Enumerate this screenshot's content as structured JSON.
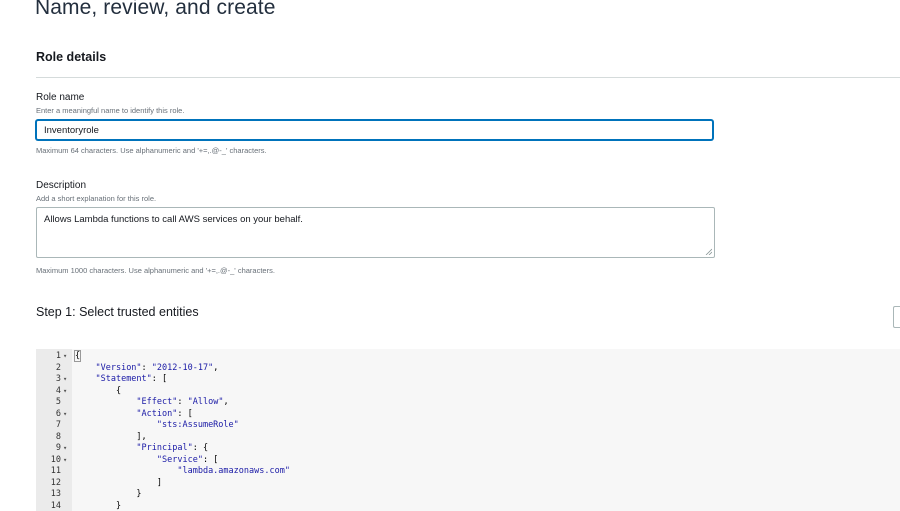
{
  "page": {
    "title": "Name, review, and create"
  },
  "role_details": {
    "title": "Role details",
    "role_name": {
      "label": "Role name",
      "hint": "Enter a meaningful name to identify this role.",
      "value": "Inventoryrole",
      "constraint": "Maximum 64 characters. Use alphanumeric and '+=,.@-_' characters."
    },
    "description": {
      "label": "Description",
      "hint": "Add a short explanation for this role.",
      "value": "Allows Lambda functions to call AWS services on your behalf.",
      "constraint": "Maximum 1000 characters. Use alphanumeric and '+=,.@-_' characters."
    }
  },
  "step1": {
    "title": "Step 1: Select trusted entities"
  },
  "code_editor": {
    "lines": [
      {
        "num": "1",
        "fold": true,
        "code": "{"
      },
      {
        "num": "2",
        "fold": false,
        "code": "    \"Version\": \"2012-10-17\","
      },
      {
        "num": "3",
        "fold": true,
        "code": "    \"Statement\": ["
      },
      {
        "num": "4",
        "fold": true,
        "code": "        {"
      },
      {
        "num": "5",
        "fold": false,
        "code": "            \"Effect\": \"Allow\","
      },
      {
        "num": "6",
        "fold": true,
        "code": "            \"Action\": ["
      },
      {
        "num": "7",
        "fold": false,
        "code": "                \"sts:AssumeRole\""
      },
      {
        "num": "8",
        "fold": false,
        "code": "            ],"
      },
      {
        "num": "9",
        "fold": true,
        "code": "            \"Principal\": {"
      },
      {
        "num": "10",
        "fold": true,
        "code": "                \"Service\": ["
      },
      {
        "num": "11",
        "fold": false,
        "code": "                    \"lambda.amazonaws.com\""
      },
      {
        "num": "12",
        "fold": false,
        "code": "                ]"
      },
      {
        "num": "13",
        "fold": false,
        "code": "            }"
      },
      {
        "num": "14",
        "fold": false,
        "code": "        }"
      }
    ]
  },
  "colors": {
    "focus_border": "#0073bb",
    "string": "#1a1aa6",
    "gutter_bg": "#ebebeb",
    "editor_bg": "#f7f7f7"
  }
}
